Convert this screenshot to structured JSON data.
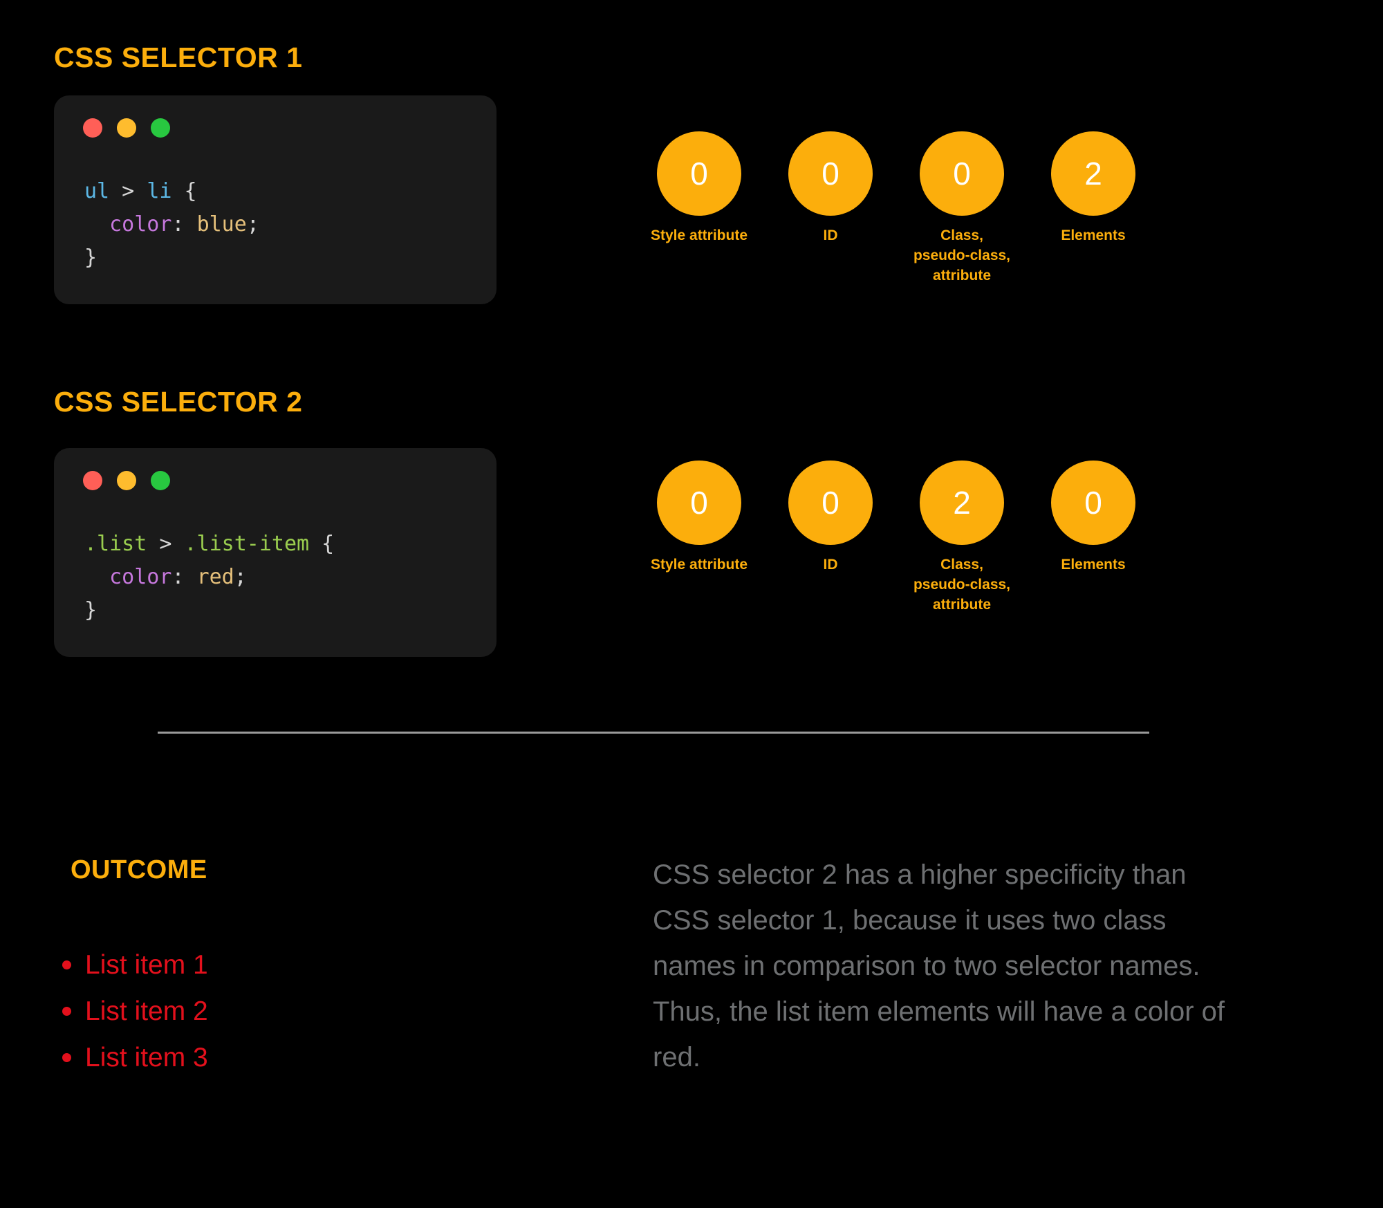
{
  "theme": {
    "background": "#000000",
    "accent_orange": "#FCAE0C",
    "card_background": "#1A1A1A",
    "red": "#E3101C",
    "gray_text": "#6E7072",
    "divider": "#9A9A9A",
    "circle_number_color": "#FFFFFF"
  },
  "sections": [
    {
      "heading": "CSS SELECTOR 1",
      "window_dots": [
        "red-dot",
        "yellow-dot",
        "green-dot"
      ],
      "code_tokens": [
        [
          {
            "text": "ul",
            "type": "el"
          },
          {
            "text": " > ",
            "type": "punct"
          },
          {
            "text": "li",
            "type": "el"
          },
          {
            "text": " {",
            "type": "brace"
          }
        ],
        [
          {
            "text": "  color",
            "type": "prop"
          },
          {
            "text": ": ",
            "type": "punct"
          },
          {
            "text": "blue",
            "type": "val"
          },
          {
            "text": ";",
            "type": "punct"
          }
        ],
        [
          {
            "text": "}",
            "type": "brace"
          }
        ]
      ],
      "code_plain": "ul > li {\n  color: blue;\n}",
      "specificity": [
        {
          "value": "0",
          "label": "Style attribute"
        },
        {
          "value": "0",
          "label": "ID"
        },
        {
          "value": "0",
          "label": "Class,\npseudo-class,\nattribute"
        },
        {
          "value": "2",
          "label": "Elements"
        }
      ]
    },
    {
      "heading": "CSS SELECTOR 2",
      "window_dots": [
        "red-dot",
        "yellow-dot",
        "green-dot"
      ],
      "code_tokens": [
        [
          {
            "text": ".list",
            "type": "class"
          },
          {
            "text": " > ",
            "type": "punct"
          },
          {
            "text": ".list-item",
            "type": "class"
          },
          {
            "text": " {",
            "type": "brace"
          }
        ],
        [
          {
            "text": "  color",
            "type": "prop"
          },
          {
            "text": ": ",
            "type": "punct"
          },
          {
            "text": "red",
            "type": "val"
          },
          {
            "text": ";",
            "type": "punct"
          }
        ],
        [
          {
            "text": "}",
            "type": "brace"
          }
        ]
      ],
      "code_plain": ".list > .list-item {\n  color: red;\n}",
      "specificity": [
        {
          "value": "0",
          "label": "Style attribute"
        },
        {
          "value": "0",
          "label": "ID"
        },
        {
          "value": "2",
          "label": "Class,\npseudo-class,\nattribute"
        },
        {
          "value": "0",
          "label": "Elements"
        }
      ]
    }
  ],
  "outcome": {
    "title": "OUTCOME",
    "items": [
      "List item 1",
      "List item 2",
      "List item 3"
    ],
    "explanation": "CSS selector 2 has a higher specificity than CSS selector 1, because it uses two class names in comparison to two selector names. Thus, the list item elements will have a color of red."
  }
}
